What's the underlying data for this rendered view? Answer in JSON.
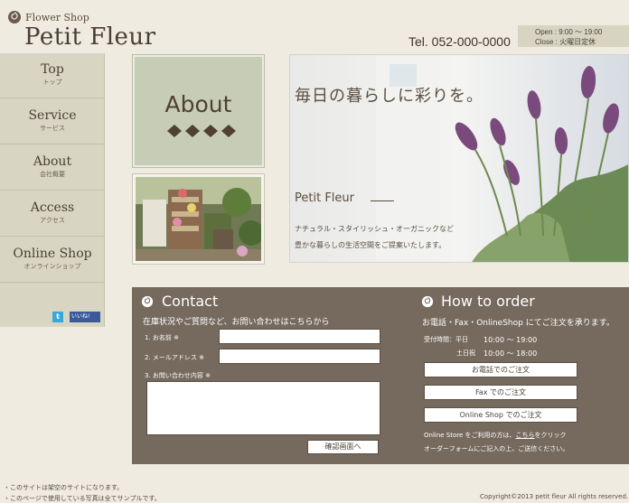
{
  "header": {
    "logo_small": "Flower Shop",
    "logo_main": "Petit Fleur",
    "tel": "Tel.  052-000-0000",
    "hours_line1": "Open : 9:00 〜 19:00",
    "hours_line2": "Close : 火曜日定休"
  },
  "nav": [
    {
      "label": "Top",
      "sub": "トップ"
    },
    {
      "label": "Service",
      "sub": "サービス"
    },
    {
      "label": "About",
      "sub": "会社概要"
    },
    {
      "label": "Access",
      "sub": "アクセス"
    },
    {
      "label": "Online Shop",
      "sub": "オンラインショップ"
    }
  ],
  "social": {
    "twitter": "t",
    "facebook": "いいね!"
  },
  "about": {
    "title": "About"
  },
  "hero": {
    "headline": "毎日の暮らしに彩りを。",
    "brand": "Petit Fleur",
    "desc1": "ナチュラル・スタイリッシュ・オーガニックなど",
    "desc2": "豊かな暮らしの生活空間をご提案いたします。"
  },
  "contact": {
    "title": "Contact",
    "intro": "在庫状況やご質問など、お問い合わせはこちらから",
    "name_label": "1. お名前 ※",
    "email_label": "2. メールアドレス ※",
    "message_label": "3. お問い合わせ内容 ※",
    "submit": "確認画面へ"
  },
  "order": {
    "title": "How to order",
    "intro": "お電話・Fax・OnlineShop にてご注文を承ります。",
    "hours_label": "受付時間：平日",
    "hours_weekday": "10:00 〜 19:00",
    "hours_weekend_label": "土日祝",
    "hours_weekend": "10:00 〜 18:00",
    "btn_phone": "お電話でのご注文",
    "btn_fax": "Fax でのご注文",
    "btn_online": "Online Shop でのご注文",
    "note1_pre": "Online Store をご利用の方は、",
    "note1_link": "こちら",
    "note1_post": "をクリック",
    "note2": "オーダーフォームにご記入の上、ご送信ください。"
  },
  "footer": {
    "note1": "・このサイトは架空のサイトになります。",
    "note2": "・このページで使用している写真は全てサンプルです。",
    "copyright": "Copyright©2013 petit fleur All rights reserved."
  },
  "colors": {
    "background": "#efebe0",
    "sidebar": "#d8d6c3",
    "about_card": "#c7ccb6",
    "panel": "#76695e",
    "text": "#4a3f36"
  },
  "icons": [
    "rose-logo-icon",
    "rose-icon",
    "twitter-icon",
    "facebook-icon",
    "leaf-ornament-icon"
  ]
}
